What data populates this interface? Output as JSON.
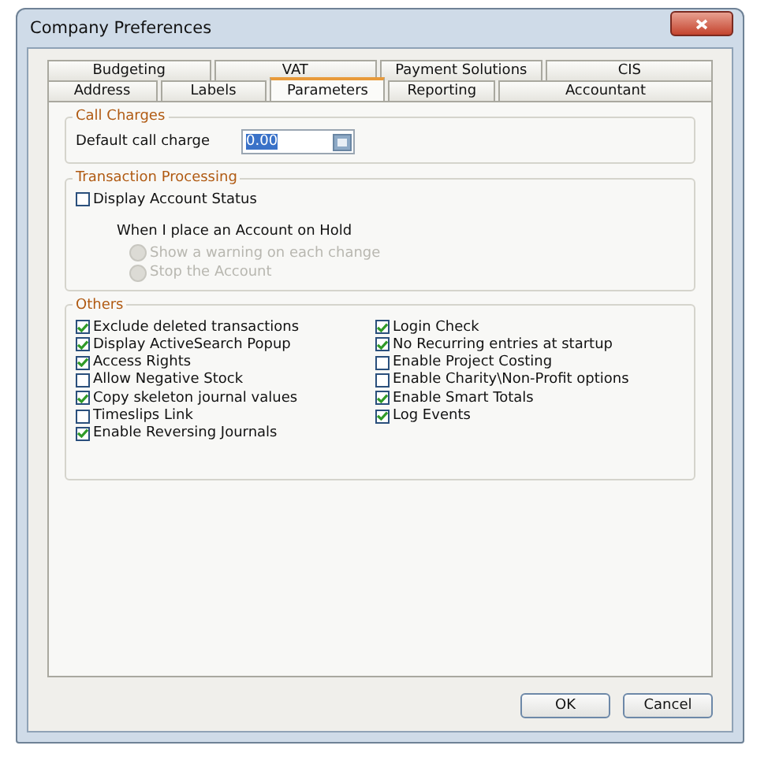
{
  "window": {
    "title": "Company Preferences"
  },
  "tab_rows": [
    {
      "tabs": [
        {
          "label": "Budgeting",
          "selected": false
        },
        {
          "label": "VAT",
          "selected": false
        },
        {
          "label": "Payment Solutions",
          "selected": false
        },
        {
          "label": "CIS",
          "selected": false
        }
      ]
    },
    {
      "tabs": [
        {
          "label": "Address",
          "selected": false
        },
        {
          "label": "Labels",
          "selected": false
        },
        {
          "label": "Parameters",
          "selected": true
        },
        {
          "label": "Reporting",
          "selected": false
        },
        {
          "label": "Accountant",
          "selected": false
        }
      ]
    }
  ],
  "call_charges": {
    "title": "Call Charges",
    "label": "Default call charge",
    "value": "0.00"
  },
  "transaction_processing": {
    "title": "Transaction Processing",
    "checkbox": {
      "label": "Display Account Status",
      "checked": false
    },
    "subheading": "When I place an Account on Hold",
    "radios": [
      {
        "label": "Show a warning on each change",
        "selected": false,
        "disabled": true
      },
      {
        "label": "Stop the Account",
        "selected": false,
        "disabled": true
      }
    ]
  },
  "others": {
    "title": "Others",
    "columns": [
      [
        {
          "label": "Exclude deleted transactions",
          "checked": true
        },
        {
          "label": "Display ActiveSearch Popup",
          "checked": true
        },
        {
          "label": "Access Rights",
          "checked": true
        },
        {
          "label": "Allow Negative Stock",
          "checked": false
        },
        {
          "label": "Copy skeleton journal values",
          "checked": true
        },
        {
          "label": "Timeslips Link",
          "checked": false
        },
        {
          "label": "Enable Reversing Journals",
          "checked": true
        }
      ],
      [
        {
          "label": "Login Check",
          "checked": true
        },
        {
          "label": "No Recurring entries at startup",
          "checked": true
        },
        {
          "label": "Enable Project Costing",
          "checked": false
        },
        {
          "label": "Enable Charity\\Non-Profit options",
          "checked": false
        },
        {
          "label": "Enable Smart Totals",
          "checked": true
        },
        {
          "label": "Log Events",
          "checked": true
        }
      ]
    ]
  },
  "buttons": [
    "OK",
    "Cancel"
  ]
}
